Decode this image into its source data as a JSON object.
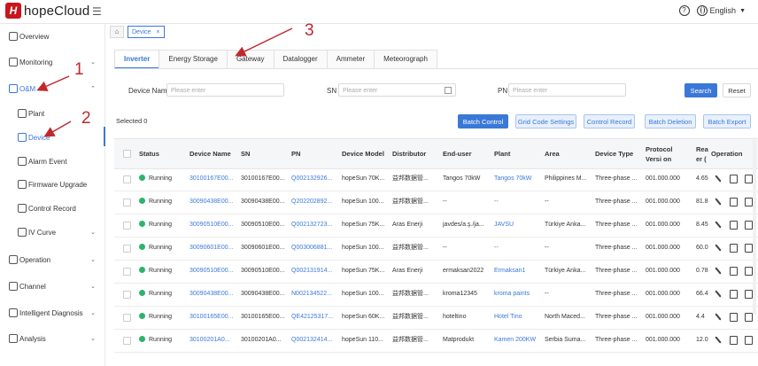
{
  "header": {
    "logo_mark": "H",
    "logo_text": "hopeCloud",
    "menu_icon": "hamburger-icon",
    "help_icon": "?",
    "language": "English"
  },
  "sidebar": {
    "items": [
      {
        "label": "Overview",
        "icon": "overview-icon"
      },
      {
        "label": "Monitoring",
        "icon": "monitor-icon",
        "arrow": "⌄"
      },
      {
        "label": "O&M",
        "icon": "om-icon",
        "arrow": "⌃"
      },
      {
        "label": "Plant",
        "icon": "plant-icon"
      },
      {
        "label": "Device",
        "icon": "device-icon"
      },
      {
        "label": "Alarm Event",
        "icon": "alarm-icon"
      },
      {
        "label": "Firmware Upgrade",
        "icon": "firmware-icon"
      },
      {
        "label": "Control Record",
        "icon": "record-icon"
      },
      {
        "label": "IV Curve",
        "icon": "curve-icon",
        "arrow": "⌄"
      },
      {
        "label": "Operation",
        "icon": "operation-icon",
        "arrow": "⌄"
      },
      {
        "label": "Channel",
        "icon": "channel-icon",
        "arrow": "⌄"
      },
      {
        "label": "Intelligent Diagnosis",
        "icon": "diagnosis-icon",
        "arrow": "⌄"
      },
      {
        "label": "Analysis",
        "icon": "analysis-icon",
        "arrow": "⌄"
      }
    ]
  },
  "breadcrumb": {
    "tab_label": "Device",
    "close": "×"
  },
  "tabs": [
    "Inverter",
    "Energy Storage",
    "Gateway",
    "Datalogger",
    "Ammeter",
    "Meteorograph"
  ],
  "filters": {
    "device_name_label": "Device Name",
    "device_name_placeholder": "Please enter",
    "sn_label": "SN",
    "sn_placeholder": "Please enter",
    "pn_label": "PN",
    "pn_placeholder": "Please enter",
    "search": "Search",
    "reset": "Reset"
  },
  "actions": {
    "selected": "Selected 0",
    "batch_control": "Batch Control",
    "grid_code": "Grid Code Settings",
    "control_record": "Control Record",
    "batch_deletion": "Batch Deletion",
    "batch_export": "Batch Export"
  },
  "table": {
    "headers": [
      "Status",
      "Device Name",
      "SN",
      "PN",
      "Device Model",
      "Distributor",
      "End-user",
      "Plant",
      "Area",
      "Device Type",
      "Protocol Versi on",
      "Rea er (",
      "Operation"
    ],
    "rows": [
      {
        "status": "Running",
        "name": "30100167E00...",
        "sn": "30100167E00...",
        "pn": "Q002132926...",
        "model": "hopeSun 70K...",
        "dist": "益邦数据管...",
        "user": "Tangos 70kW",
        "plant": "Tangos 70kW",
        "area": "Philippines M...",
        "type": "Three-phase ...",
        "proto": "001.000.000",
        "rea": "4.65"
      },
      {
        "status": "Running",
        "name": "30090438E00...",
        "sn": "30090438E00...",
        "pn": "Q202202892...",
        "model": "hopeSun 100...",
        "dist": "益邦数据管...",
        "user": "--",
        "plant": "--",
        "area": "--",
        "type": "Three-phase ...",
        "proto": "001.000.000",
        "rea": "81.8"
      },
      {
        "status": "Running",
        "name": "30090510E00...",
        "sn": "30090510E00...",
        "pn": "Q002132723...",
        "model": "hopeSun 75K...",
        "dist": "Aras Enerji",
        "user": "javdes/a.ş./ja...",
        "plant": "JAVSU",
        "area": "Türkiye Anka...",
        "type": "Three-phase ...",
        "proto": "001.000.000",
        "rea": "8.45"
      },
      {
        "status": "Running",
        "name": "30090601E00...",
        "sn": "30090601E00...",
        "pn": "Q003006881...",
        "model": "hopeSun 100...",
        "dist": "益邦数据管...",
        "user": "--",
        "plant": "--",
        "area": "--",
        "type": "Three-phase ...",
        "proto": "001.000.000",
        "rea": "60.0"
      },
      {
        "status": "Running",
        "name": "30090510E00...",
        "sn": "30090510E00...",
        "pn": "Q002131914...",
        "model": "hopeSun 75K...",
        "dist": "Aras Enerji",
        "user": "ermaksan2022",
        "plant": "Ermaksan1",
        "area": "Türkiye Anka...",
        "type": "Three-phase ...",
        "proto": "001.000.000",
        "rea": "0.78"
      },
      {
        "status": "Running",
        "name": "30090438E00...",
        "sn": "30090438E00...",
        "pn": "N002134522...",
        "model": "hopeSun 100...",
        "dist": "益邦数据管...",
        "user": "kroma12345",
        "plant": "kroma paints",
        "area": "--",
        "type": "Three-phase ...",
        "proto": "001.000.000",
        "rea": "66.4"
      },
      {
        "status": "Running",
        "name": "30100165E00...",
        "sn": "30100165E00...",
        "pn": "QE42125317...",
        "model": "hopeSun 60K...",
        "dist": "益邦数据管...",
        "user": "hoteltino",
        "plant": "Hotel Tino",
        "area": "North Maced...",
        "type": "Three-phase ...",
        "proto": "001.000.000",
        "rea": "4.4"
      },
      {
        "status": "Running",
        "name": "30100201A0...",
        "sn": "30100201A0...",
        "pn": "Q002132414...",
        "model": "hopeSun 110...",
        "dist": "益邦数据管...",
        "user": "Matprodukt",
        "plant": "Kamen 200KW",
        "area": "Serbia Suma...",
        "type": "Three-phase ...",
        "proto": "001.000.000",
        "rea": "12.0"
      }
    ]
  },
  "annotations": [
    "1",
    "2",
    "3"
  ],
  "colors": {
    "accent": "#3a78d8",
    "running": "#2bb56a",
    "annotation": "#c0282d"
  }
}
